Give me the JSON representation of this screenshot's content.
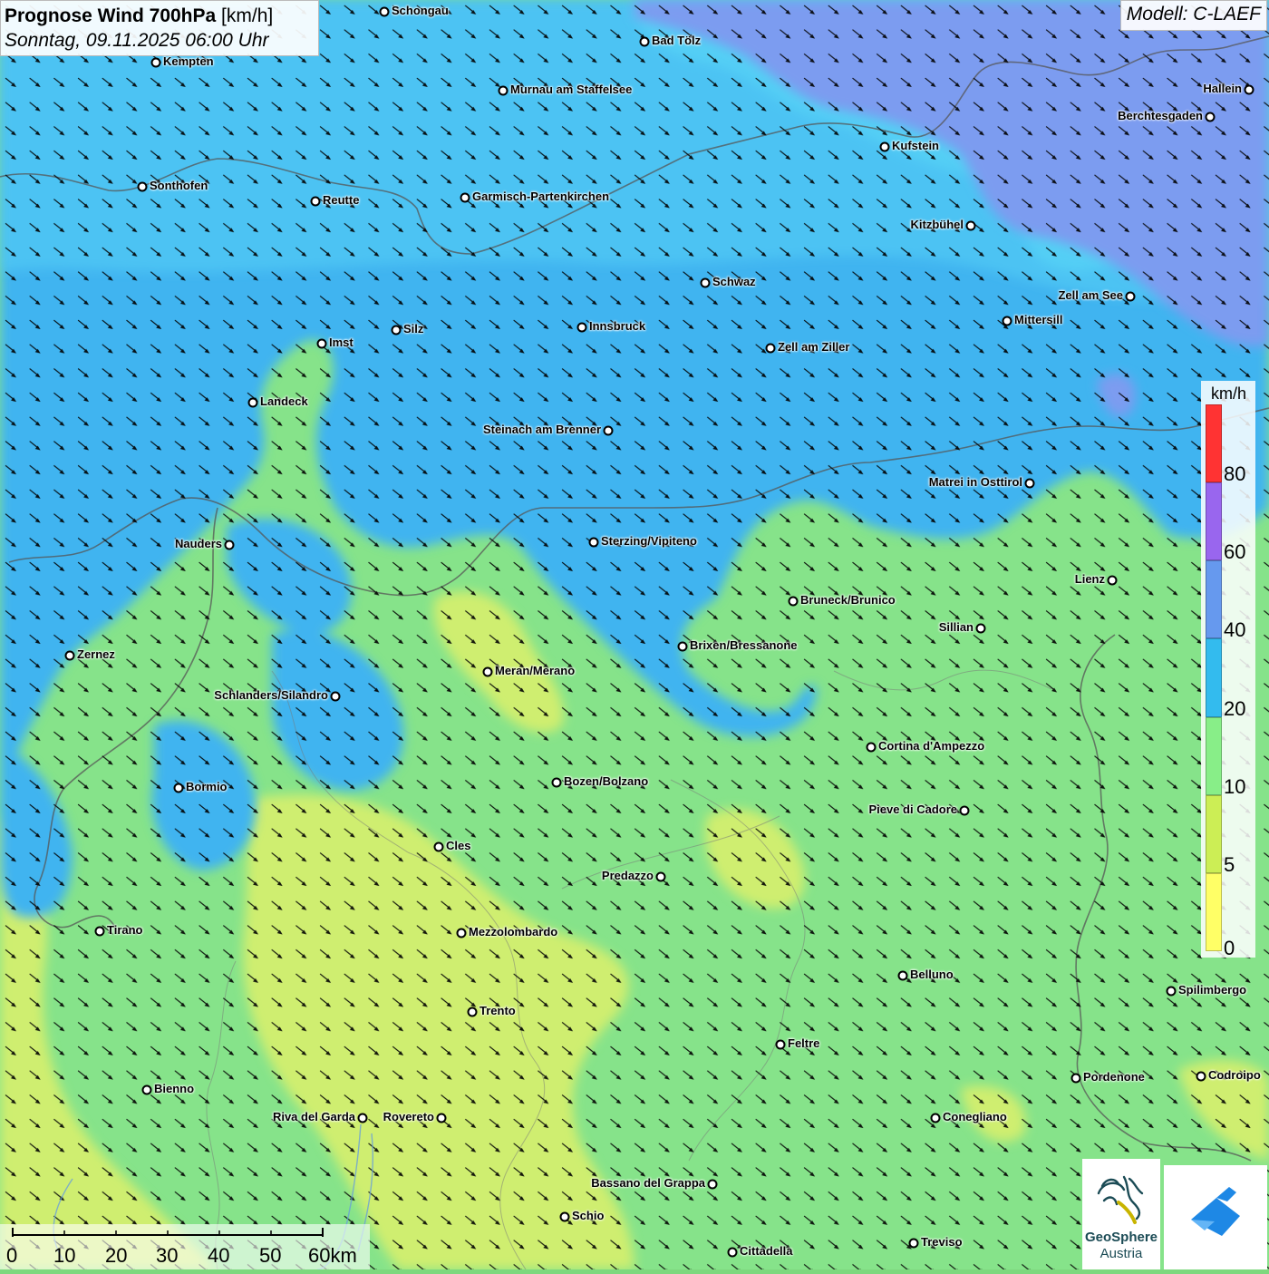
{
  "header": {
    "title_bold": "Prognose Wind 700hPa",
    "title_unit": "[km/h]",
    "subtitle": "Sonntag, 09.11.2025 06:00 Uhr",
    "model": "Modell: C-LAEF"
  },
  "legend": {
    "unit": "km/h",
    "labels": [
      "80",
      "60",
      "40",
      "20",
      "10",
      "5",
      "0"
    ],
    "colors": [
      "#ff3333",
      "#9966ee",
      "#6699ee",
      "#33bbee",
      "#88ee88",
      "#ccee55",
      "#ffff66"
    ]
  },
  "scale": {
    "labels": [
      "0",
      "10",
      "20",
      "30",
      "40",
      "50",
      "60km"
    ]
  },
  "logos": {
    "geosphere_line1": "GeoSphere",
    "geosphere_line2": "Austria"
  },
  "colors": {
    "high": "#7b9cf0",
    "mid": "#3fb4f0",
    "cyan": "#55d0f5",
    "low": "#86e38a",
    "lowest": "#cfee70"
  },
  "cities": [
    {
      "name": "Schongau",
      "side": "right"
    },
    {
      "name": "Bad Tölz",
      "side": "right"
    },
    {
      "name": "Kempten",
      "side": "right"
    },
    {
      "name": "Murnau am Staffelsee",
      "side": "right"
    },
    {
      "name": "Hallein",
      "side": "left"
    },
    {
      "name": "Berchtesgaden",
      "side": "left"
    },
    {
      "name": "Kufstein",
      "side": "right"
    },
    {
      "name": "Sonthofen",
      "side": "right"
    },
    {
      "name": "Reutte",
      "side": "right"
    },
    {
      "name": "Garmisch-Partenkirchen",
      "side": "right"
    },
    {
      "name": "Kitzbühel",
      "side": "left"
    },
    {
      "name": "Schwaz",
      "side": "right"
    },
    {
      "name": "Zell am See",
      "side": "left"
    },
    {
      "name": "Silz",
      "side": "right"
    },
    {
      "name": "Innsbruck",
      "side": "right"
    },
    {
      "name": "Mittersill",
      "side": "right"
    },
    {
      "name": "Imst",
      "side": "right"
    },
    {
      "name": "Zell am Ziller",
      "side": "right"
    },
    {
      "name": "Landeck",
      "side": "right"
    },
    {
      "name": "Steinach am Brenner",
      "side": "left"
    },
    {
      "name": "Matrei in Osttirol",
      "side": "left"
    },
    {
      "name": "Nauders",
      "side": "left"
    },
    {
      "name": "Sterzing/Vipiteno",
      "side": "right"
    },
    {
      "name": "Lienz",
      "side": "left"
    },
    {
      "name": "Bruneck/Brunico",
      "side": "right"
    },
    {
      "name": "Sillian",
      "side": "left"
    },
    {
      "name": "Brixen/Bressanone",
      "side": "right"
    },
    {
      "name": "Zernez",
      "side": "right"
    },
    {
      "name": "Meran/Merano",
      "side": "right"
    },
    {
      "name": "Schlanders/Silandro",
      "side": "left"
    },
    {
      "name": "Cortina d'Ampezzo",
      "side": "right"
    },
    {
      "name": "Bozen/Bolzano",
      "side": "right"
    },
    {
      "name": "Bormio",
      "side": "right"
    },
    {
      "name": "Pieve di Cadore",
      "side": "left"
    },
    {
      "name": "Cles",
      "side": "right"
    },
    {
      "name": "Predazzo",
      "side": "left"
    },
    {
      "name": "Tirano",
      "side": "right"
    },
    {
      "name": "Mezzolombardo",
      "side": "right"
    },
    {
      "name": "Belluno",
      "side": "right"
    },
    {
      "name": "Spilimbergo",
      "side": "right"
    },
    {
      "name": "Trento",
      "side": "right"
    },
    {
      "name": "Feltre",
      "side": "right"
    },
    {
      "name": "Pordenone",
      "side": "right"
    },
    {
      "name": "Codroipo",
      "side": "right"
    },
    {
      "name": "Bienno",
      "side": "right"
    },
    {
      "name": "Riva del Garda",
      "side": "left"
    },
    {
      "name": "Rovereto",
      "side": "left"
    },
    {
      "name": "Conegliano",
      "side": "right"
    },
    {
      "name": "Bassano del Grappa",
      "side": "left"
    },
    {
      "name": "Schio",
      "side": "right"
    },
    {
      "name": "Treviso",
      "side": "right"
    },
    {
      "name": "Cittadella",
      "side": "right"
    }
  ]
}
